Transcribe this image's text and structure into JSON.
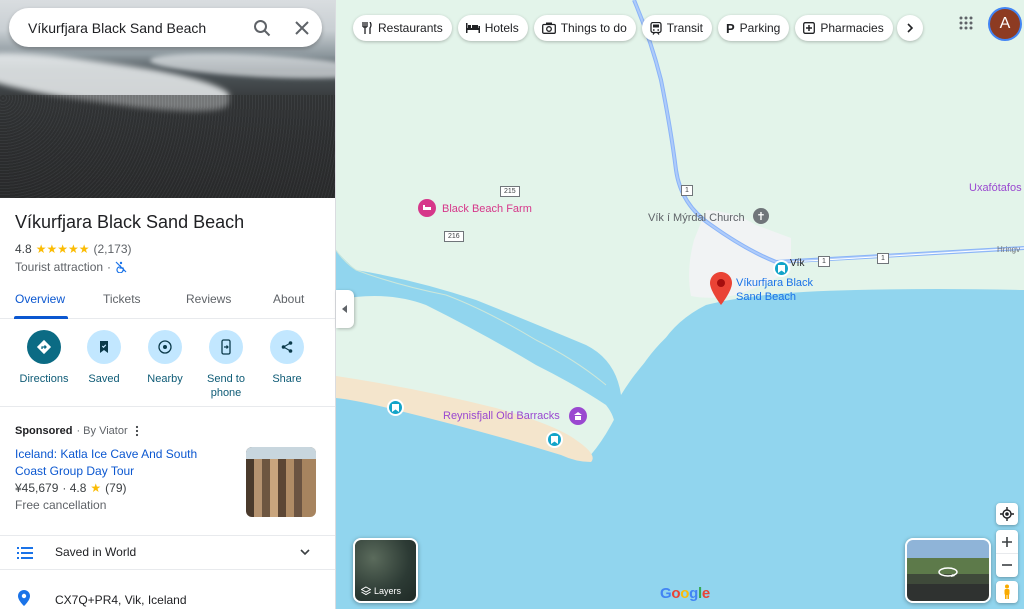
{
  "search": {
    "value": "Víkurfjara Black Sand Beach"
  },
  "place": {
    "title": "Víkurfjara Black Sand Beach",
    "rating": "4.8",
    "stars": "★★★★★",
    "review_count": "(2,173)",
    "category": "Tourist attraction",
    "separator": "·"
  },
  "tabs": [
    {
      "label": "Overview",
      "active": true
    },
    {
      "label": "Tickets"
    },
    {
      "label": "Reviews"
    },
    {
      "label": "About"
    }
  ],
  "actions": [
    {
      "label": "Directions",
      "icon": "directions-icon"
    },
    {
      "label": "Saved",
      "icon": "bookmark-icon"
    },
    {
      "label": "Nearby",
      "icon": "nearby-icon"
    },
    {
      "label": "Send to phone",
      "icon": "send-to-phone-icon"
    },
    {
      "label": "Share",
      "icon": "share-icon"
    }
  ],
  "sponsored": {
    "label": "Sponsored",
    "by": "· By Viator",
    "title": "Iceland: Katla Ice Cave And South Coast Group Day Tour",
    "price": "¥45,679",
    "rating": "· 4.8",
    "star": "★",
    "reviews": "(79)",
    "cancellation": "Free cancellation"
  },
  "saved_list": {
    "label": "Saved in World"
  },
  "address": {
    "value": "CX7Q+PR4, Vik, Iceland"
  },
  "chips": [
    {
      "label": "Restaurants",
      "icon": "restaurant-icon"
    },
    {
      "label": "Hotels",
      "icon": "hotel-icon"
    },
    {
      "label": "Things to do",
      "icon": "camera-icon"
    },
    {
      "label": "Transit",
      "icon": "transit-icon"
    },
    {
      "label": "Parking",
      "icon": "parking-icon"
    },
    {
      "label": "Pharmacies",
      "icon": "pharmacy-icon"
    }
  ],
  "user": {
    "avatar_letter": "A"
  },
  "map": {
    "labels": {
      "black_beach_farm": "Black Beach Farm",
      "church": "Vík í Mýrdal Church",
      "uxafotafoss": "Uxafótafos",
      "vikurfjara": "Víkurfjara Black Sand Beach",
      "vikurfjara_line1": "Víkurfjara Black",
      "vikurfjara_line2": "Sand Beach",
      "reynisfjall": "Reynisfjall Old Barracks",
      "vik": "Vík",
      "hringvegur": "Hringv"
    },
    "road_numbers": {
      "r215": "215",
      "r216": "216",
      "r1a": "1",
      "r1b": "1",
      "r1c": "1"
    },
    "layers_label": "Layers",
    "google_logo": "Google"
  },
  "colors": {
    "accent": "#0b57d0",
    "primary_action": "#0b6b84",
    "star": "#fbbc04",
    "water": "#91d5ee",
    "land": "#e3f4ea",
    "sand": "#f4e5cc",
    "farm_pink": "#d6378a",
    "poi_purple": "#9a48d0",
    "marker_red": "#ea4335"
  }
}
